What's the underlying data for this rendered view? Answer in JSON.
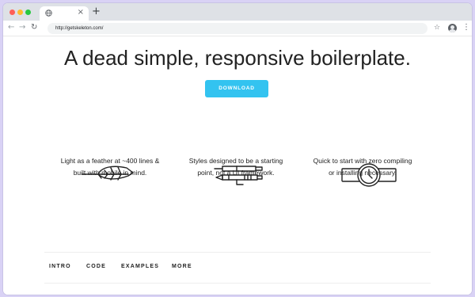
{
  "browser": {
    "url": "http://getskeleton.com/",
    "new_tab_label": "+",
    "close_tab_label": "×",
    "back_label": "←",
    "forward_label": "→",
    "reload_label": "↻",
    "bookmark_label": "☆",
    "menu_label": "⋮"
  },
  "hero": {
    "headline": "A dead simple, responsive boilerplate.",
    "download_label": "DOWNLOAD"
  },
  "features": [
    {
      "icon": "feather-icon",
      "line1": "Light as a feather at ~400 lines &",
      "line2": "built with mobile in mind."
    },
    {
      "icon": "pens-icon",
      "line1": "Styles designed to be a starting",
      "line2": "point, not a UI framework."
    },
    {
      "icon": "watch-icon",
      "line1": "Quick to start with zero compiling",
      "line2": "or installing necessary."
    }
  ],
  "nav": {
    "items": [
      "INTRO",
      "CODE",
      "EXAMPLES",
      "MORE"
    ]
  },
  "colors": {
    "accent": "#33c3f0",
    "background": "#d9d2f5",
    "text": "#222222"
  }
}
